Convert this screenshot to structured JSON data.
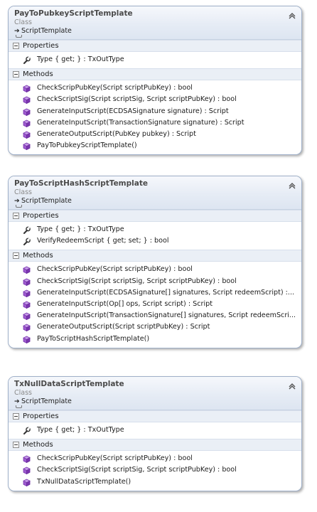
{
  "classes": [
    {
      "name": "PayToPubkeyScriptTemplate",
      "kind": "Class",
      "base": "ScriptTemplate",
      "properties_label": "Properties",
      "properties": [
        {
          "text": "Type { get; } : TxOutType",
          "icon": "wrench-icon"
        }
      ],
      "methods_label": "Methods",
      "methods": [
        {
          "text": "CheckScripPubKey(Script scriptPubKey) : bool",
          "icon": "method-cube-icon"
        },
        {
          "text": "CheckScriptSig(Script scriptSig, Script scriptPubKey) : bool",
          "icon": "method-cube-icon"
        },
        {
          "text": "GenerateInputScript(ECDSASignature signature) : Script",
          "icon": "method-cube-icon"
        },
        {
          "text": "GenerateInputScript(TransactionSignature signature) : Script",
          "icon": "method-cube-icon"
        },
        {
          "text": "GenerateOutputScript(PubKey pubkey) : Script",
          "icon": "method-cube-icon"
        },
        {
          "text": "PayToPubkeyScriptTemplate()",
          "icon": "method-cube-icon"
        }
      ]
    },
    {
      "name": "PayToScriptHashScriptTemplate",
      "kind": "Class",
      "base": "ScriptTemplate",
      "properties_label": "Properties",
      "properties": [
        {
          "text": "Type { get; } : TxOutType",
          "icon": "wrench-icon"
        },
        {
          "text": "VerifyRedeemScript { get; set; } : bool",
          "icon": "wrench-icon"
        }
      ],
      "methods_label": "Methods",
      "methods": [
        {
          "text": "CheckScripPubKey(Script scriptPubKey) : bool",
          "icon": "method-cube-icon"
        },
        {
          "text": "CheckScriptSig(Script scriptSig, Script scriptPubKey) : bool",
          "icon": "method-cube-icon"
        },
        {
          "text": "GenerateInputScript(ECDSASignature[]  signatures,  Script  redeemScript)  :...",
          "icon": "method-cube-icon"
        },
        {
          "text": "GenerateInputScript(Op[] ops, Script script) : Script",
          "icon": "method-cube-icon"
        },
        {
          "text": "GenerateInputScript(TransactionSignature[]  signatures,  Script  redeemScri...",
          "icon": "method-cube-icon"
        },
        {
          "text": "GenerateOutputScript(Script scriptPubKey) : Script",
          "icon": "method-cube-icon"
        },
        {
          "text": "PayToScriptHashScriptTemplate()",
          "icon": "method-cube-icon"
        }
      ]
    },
    {
      "name": "TxNullDataScriptTemplate",
      "kind": "Class",
      "base": "ScriptTemplate",
      "properties_label": "Properties",
      "properties": [
        {
          "text": "Type { get; } : TxOutType",
          "icon": "wrench-icon"
        }
      ],
      "methods_label": "Methods",
      "methods": [
        {
          "text": "CheckScripPubKey(Script scriptPubKey) : bool",
          "icon": "method-cube-icon"
        },
        {
          "text": "CheckScriptSig(Script scriptSig, Script scriptPubKey) : bool",
          "icon": "method-cube-icon"
        },
        {
          "text": "TxNullDataScriptTemplate()",
          "icon": "method-cube-icon"
        }
      ]
    }
  ],
  "colors": {
    "border": "#9fb0c9",
    "header_gradient_top": "#f6f8fc",
    "header_gradient_bottom": "#dde5f1",
    "section_bg": "#eaeff6",
    "method_icon": "#8e4fc2"
  }
}
